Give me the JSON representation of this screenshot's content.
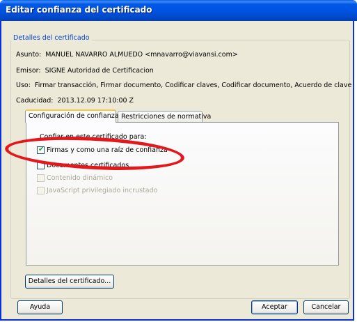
{
  "window": {
    "title": "Editar confianza del certificado"
  },
  "details": {
    "legend": "Detalles del certificado",
    "subject_label": "Asunto:",
    "subject_value": "MANUEL NAVARRO ALMUEDO <mnavarro@viavansi.com>",
    "issuer_label": "Emisor:",
    "issuer_value": "SIGNE Autoridad de Certificacion",
    "usage_label": "Uso:",
    "usage_value": "Firmar transacción, Firmar documento, Codificar claves, Codificar documento, Acuerdo de clave",
    "expiry_label": "Caducidad:",
    "expiry_value": "2013.12.09 17:10:00 Z"
  },
  "tabs": [
    {
      "label": "Configuración de confianza",
      "active": true
    },
    {
      "label": "Restricciones de normativa",
      "active": false
    }
  ],
  "trust_panel": {
    "heading": "Confiar en este certificado para:",
    "options": [
      {
        "label": "Firmas y como una raíz de confianza",
        "checked": true,
        "enabled": true
      },
      {
        "label": "Documentos certificados",
        "checked": false,
        "enabled": true
      },
      {
        "label": "Contenido dinámico",
        "checked": false,
        "enabled": false
      },
      {
        "label": "JavaScript privilegiado incrustado",
        "checked": false,
        "enabled": false
      }
    ]
  },
  "buttons": {
    "details": "Detalles del certificado...",
    "help": "Ayuda",
    "accept": "Aceptar",
    "cancel": "Cancelar"
  },
  "colors": {
    "titlebar": "#0054e3",
    "legend_text": "#0046d5",
    "annotation": "#e3181d",
    "checkmark": "#21a121"
  }
}
